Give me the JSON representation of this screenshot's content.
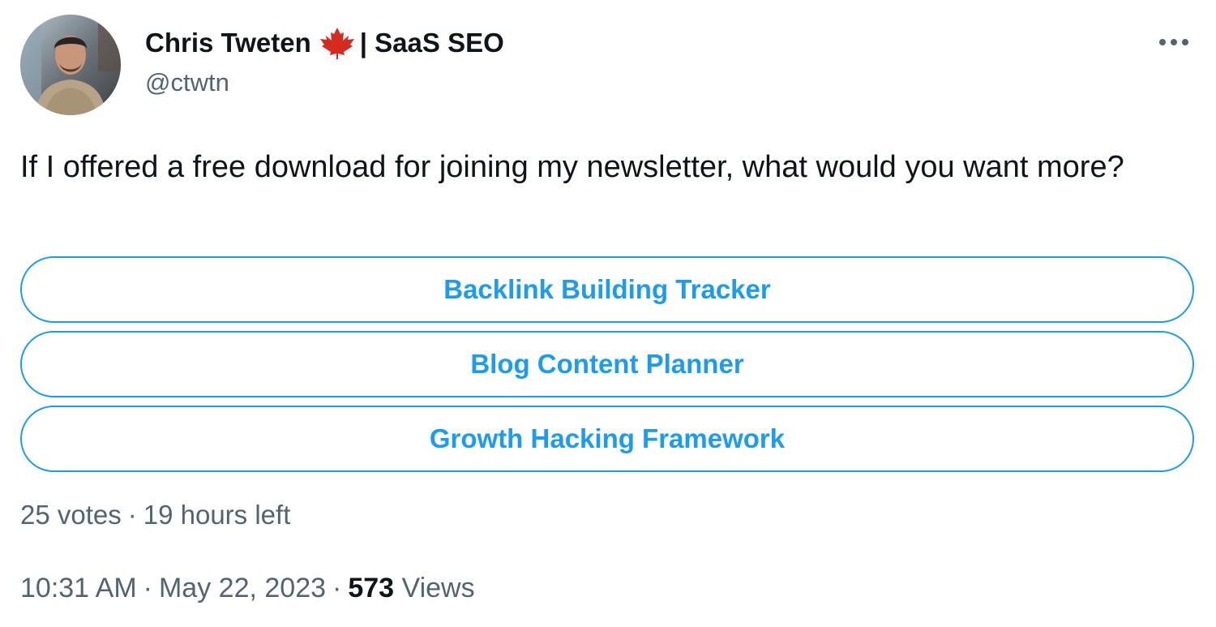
{
  "author": {
    "display_name": "Chris Tweten",
    "flag_icon": "canada-maple-leaf-icon",
    "name_suffix": "| SaaS SEO",
    "handle": "@ctwtn"
  },
  "more_icon": "more-options-icon",
  "tweet": {
    "text": "If I offered a free download for joining my newsletter, what would you want more?"
  },
  "poll": {
    "options": [
      {
        "label": "Backlink Building Tracker"
      },
      {
        "label": "Blog Content Planner"
      },
      {
        "label": "Growth Hacking Framework"
      }
    ],
    "votes": "25 votes",
    "separator": "·",
    "time_left": "19 hours left"
  },
  "meta": {
    "time": "10:31 AM",
    "separator": "·",
    "date": "May 22, 2023",
    "views_count": "573",
    "views_label": "Views"
  },
  "colors": {
    "accent": "#1d9bf0",
    "text_primary": "#0f1419",
    "text_secondary": "#536471",
    "flag_red": "#d52b1e"
  }
}
